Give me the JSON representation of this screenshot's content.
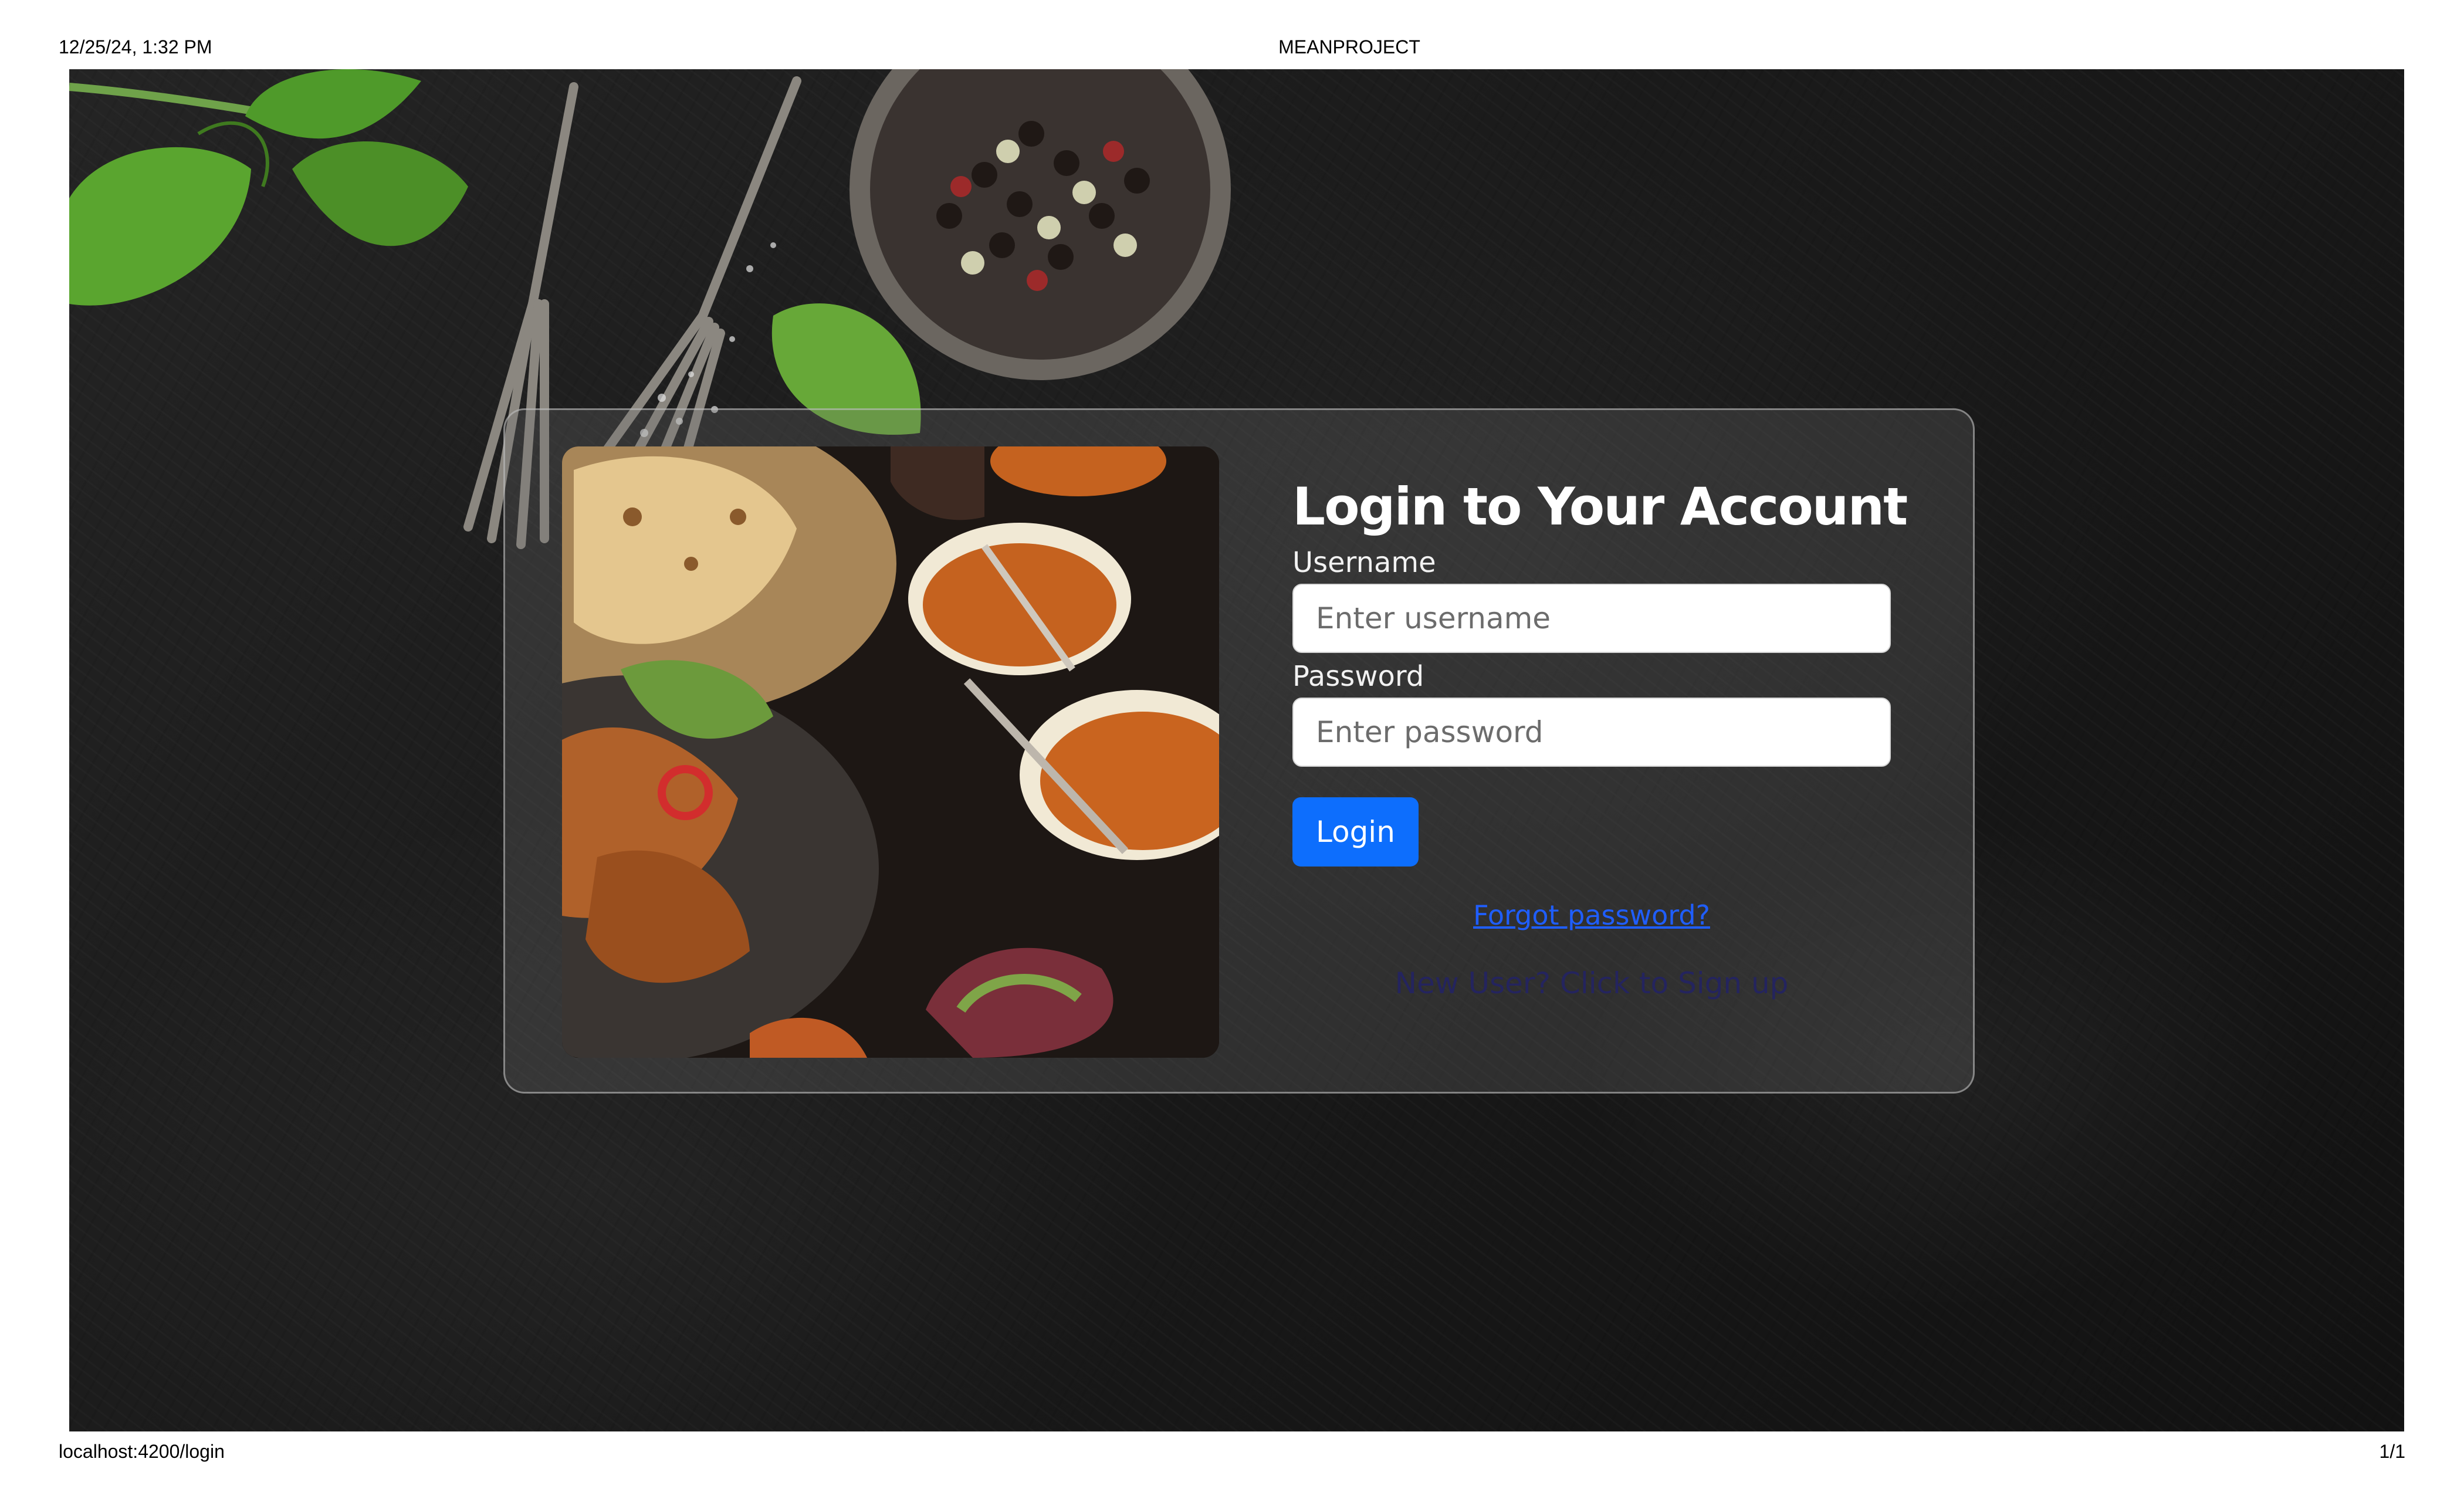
{
  "print_header": {
    "datetime": "12/25/24, 1:32 PM",
    "title": "MEANPROJECT"
  },
  "print_footer": {
    "url": "localhost:4200/login",
    "page": "1/1"
  },
  "login_form": {
    "title": "Login to Your Account",
    "username_label": "Username",
    "username_placeholder": "Enter username",
    "username_value": "",
    "password_label": "Password",
    "password_placeholder": "Enter password",
    "password_value": "",
    "login_button": "Login",
    "forgot_password": "Forgot password?",
    "signup": "New User? Click to Sign up"
  },
  "colors": {
    "primary_button": "#0d6efd",
    "forgot_link": "#1f5eff",
    "signup_link": "#24245e",
    "background": "#1a1a1a"
  }
}
